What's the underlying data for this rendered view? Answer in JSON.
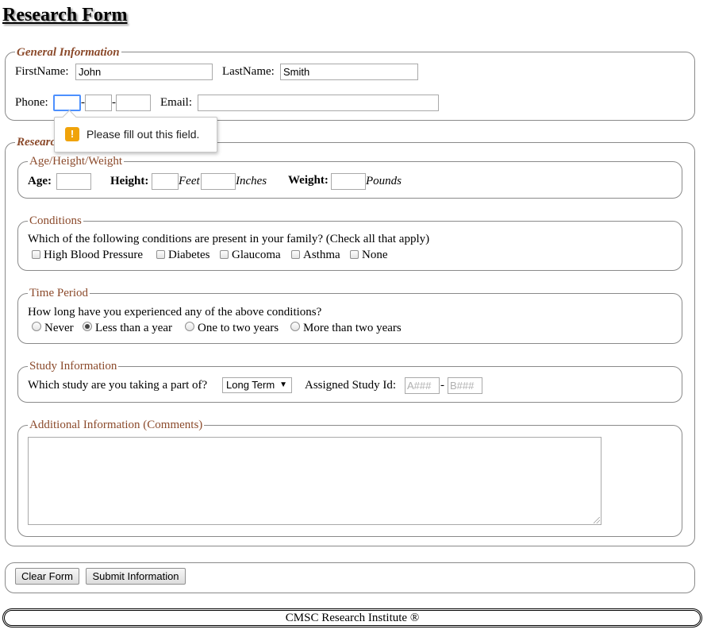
{
  "page_title": "Research Form",
  "general": {
    "legend": "General Information",
    "firstname_label": "FirstName:",
    "firstname_value": "John",
    "lastname_label": "LastName:",
    "lastname_value": "Smith",
    "phone_label": "Phone:",
    "phone_sep": "-",
    "phone_part1": "",
    "phone_part2": "",
    "phone_part3": "",
    "email_label": "Email:",
    "email_value": ""
  },
  "validation_tooltip": {
    "icon": "warning-icon",
    "text": "Please fill out this field."
  },
  "research": {
    "legend": "Research Information",
    "age_hw": {
      "legend": "Age/Height/Weight",
      "age_label": "Age:",
      "height_label": "Height:",
      "feet_unit": "Feet",
      "inches_unit": "Inches",
      "weight_label": "Weight:",
      "pounds_unit": "Pounds"
    },
    "conditions": {
      "legend": "Conditions",
      "question": "Which of the following conditions are present in your family? (Check all that apply)",
      "options": [
        "High Blood Pressure",
        "Diabetes",
        "Glaucoma",
        "Asthma",
        "None"
      ]
    },
    "time_period": {
      "legend": "Time Period",
      "question": "How long have you experienced any of the above conditions?",
      "options": [
        "Never",
        "Less than a year",
        "One to two years",
        "More than two years"
      ],
      "selected": "Less than a year"
    },
    "study": {
      "legend": "Study Information",
      "question": "Which study are you taking a part of?",
      "selected_study": "Long Term",
      "dropdown_arrow": "▼",
      "assigned_label": "Assigned Study Id:",
      "id_part1_placeholder": "A###",
      "id_sep": "-",
      "id_part2_placeholder": "B###"
    },
    "comments": {
      "legend": "Additional Information (Comments)",
      "value": ""
    }
  },
  "buttons": {
    "clear": "Clear Form",
    "submit": "Submit Information"
  },
  "footer": "CMSC Research Institute ®"
}
